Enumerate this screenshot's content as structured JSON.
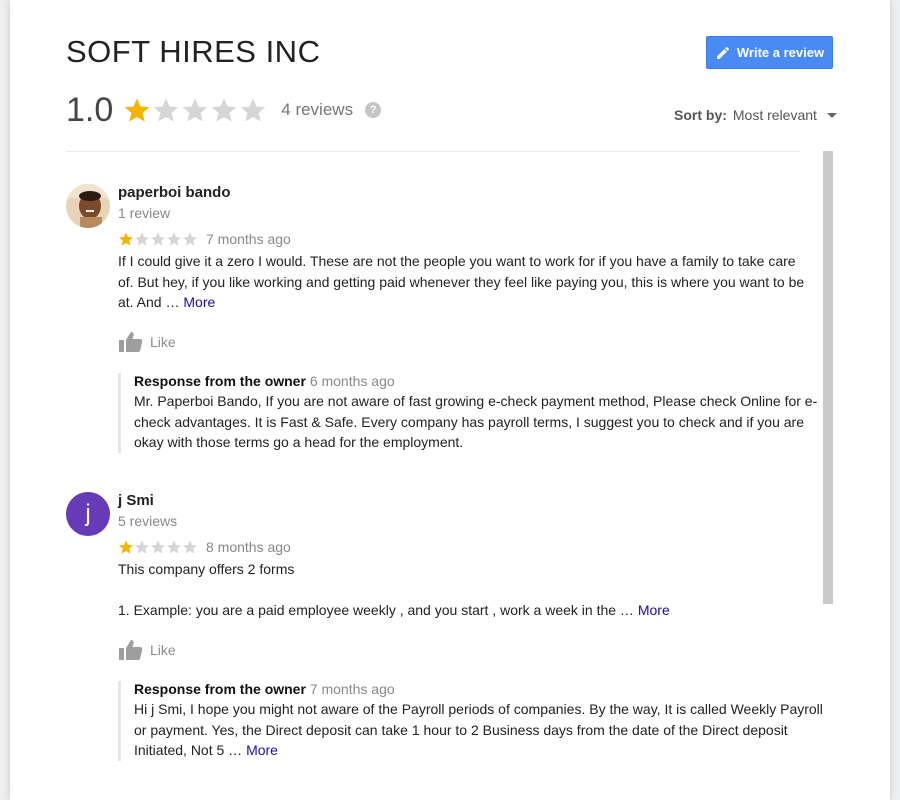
{
  "business": {
    "name": "SOFT HIRES INC"
  },
  "summary": {
    "rating": "1.0",
    "rating_value": 1,
    "max_rating": 5,
    "review_count": "4 reviews"
  },
  "write_review": {
    "label": "Write a review"
  },
  "sort": {
    "label": "Sort by:",
    "value": "Most relevant"
  },
  "colors": {
    "accent": "#4a8af4",
    "star_on": "#f4b400",
    "star_off": "#d6d6d6",
    "link": "#1a0dab",
    "avatar_j": "#673ab7"
  },
  "reviews": [
    {
      "author": "paperboi bando",
      "author_meta": "1 review",
      "stars": 1,
      "time": "7 months ago",
      "text": "If I could give it a zero I would. These are not the people you want to work for if you have a family to take care of. But hey, if you like working and getting paid whenever they feel like paying you, this is where you want to be at. And …",
      "more": "More",
      "like": "Like",
      "owner_response": {
        "label": "Response from the owner",
        "time": "6 months ago",
        "text": "Mr. Paperboi Bando, If you are not aware of fast growing e-check payment method, Please check Online for e-check advantages. It is Fast & Safe. Every company has payroll terms, I suggest you to check and if you are okay with those terms go a head for the employment."
      }
    },
    {
      "author": "j Smi",
      "author_initial": "j",
      "author_meta": "5 reviews",
      "stars": 1,
      "time": "8 months ago",
      "text_line1": "This company offers 2 forms",
      "text_line2": "1. Example: you are a paid employee weekly , and you start , work a week in the …",
      "more": "More",
      "like": "Like",
      "owner_response": {
        "label": "Response from the owner",
        "time": "7 months ago",
        "text": "Hi j Smi, I hope you might not aware of the Payroll periods of companies. By the way, It is called Weekly Payroll or payment. Yes, the Direct deposit can take 1 hour to 2 Business days from the date of the Direct deposit Initiated, Not 5 …",
        "more": "More"
      }
    }
  ]
}
